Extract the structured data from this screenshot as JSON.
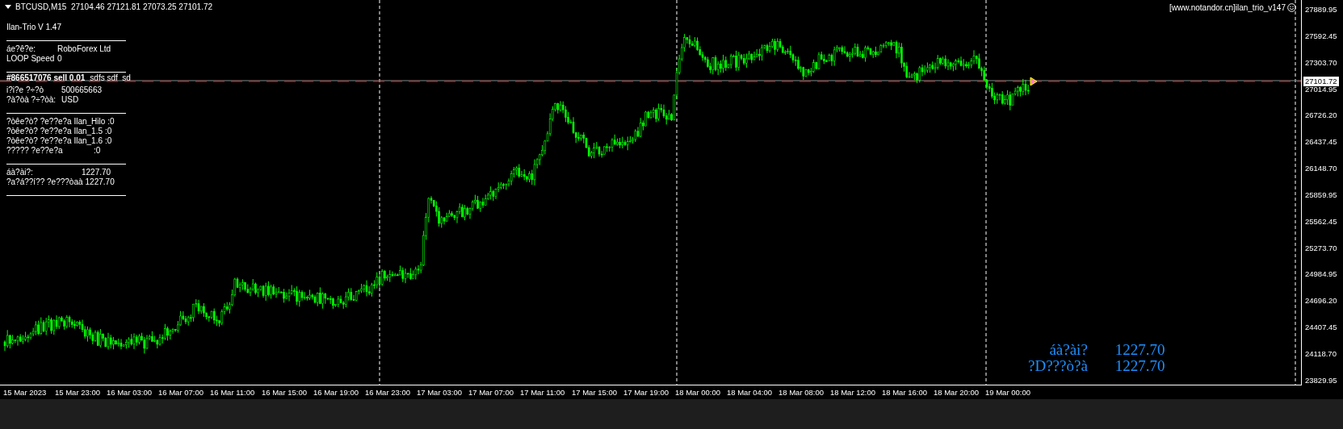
{
  "header": {
    "text": "BTCUSD,M15  27104.46 27121.81 27073.25 27101.72"
  },
  "ea_label": "[www.notandor.cn]ilan_trio_v147",
  "info_panel": {
    "title": "Ilan-Trio V 1.47",
    "sections": [
      {
        "rows": [
          {
            "label": "áe?ê?e:",
            "value": "RoboForex Ltd"
          },
          {
            "label": "LOOP Speed",
            "value": "0"
          }
        ]
      },
      {
        "order": {
          "text": "#866517076 sell 0.01",
          "comment": "sdfs sdf  sd"
        },
        "rows": [
          {
            "label": "i?i?e ?÷?ò",
            "value": "500665663"
          },
          {
            "label": "?à?òà ?÷?òà:",
            "value": "USD"
          }
        ]
      },
      {
        "rows": [
          {
            "label": "?òêe?ò? ?e??e?a Ilan_Hilo",
            "value": ":0"
          },
          {
            "label": "?òêe?ò? ?e??e?a Ilan_1.5",
            "value": ":0"
          },
          {
            "label": "?òêe?ò? ?e??e?a Ilan_1.6",
            "value": ":0"
          },
          {
            "label": "????? ?e??e?a",
            "value": ":0"
          }
        ]
      },
      {
        "rows": [
          {
            "label": "áà?ài?:",
            "value": "1227.70"
          },
          {
            "label": "?a?á??í?? ?e???òaà",
            "value": "1227.70"
          }
        ]
      }
    ]
  },
  "summary": [
    {
      "label": "áà?ài?",
      "value": "1227.70"
    },
    {
      "label": "?D???ò?à",
      "value": "1227.70"
    }
  ],
  "price_axis": [
    "27889.95",
    "27592.45",
    "27303.70",
    "27014.95",
    "26726.20",
    "26437.45",
    "26148.70",
    "25859.95",
    "25562.45",
    "25273.70",
    "24984.95",
    "24696.20",
    "24407.45",
    "24118.70",
    "23829.95"
  ],
  "current_price": "27101.72",
  "time_axis": [
    "15 Mar 2023",
    "15 Mar 23:00",
    "16 Mar 03:00",
    "16 Mar 07:00",
    "16 Mar 11:00",
    "16 Mar 15:00",
    "16 Mar 19:00",
    "16 Mar 23:00",
    "17 Mar 03:00",
    "17 Mar 07:00",
    "17 Mar 11:00",
    "17 Mar 15:00",
    "17 Mar 19:00",
    "18 Mar 00:00",
    "18 Mar 04:00",
    "18 Mar 08:00",
    "18 Mar 12:00",
    "18 Mar 16:00",
    "18 Mar 20:00",
    "19 Mar 00:00"
  ]
}
